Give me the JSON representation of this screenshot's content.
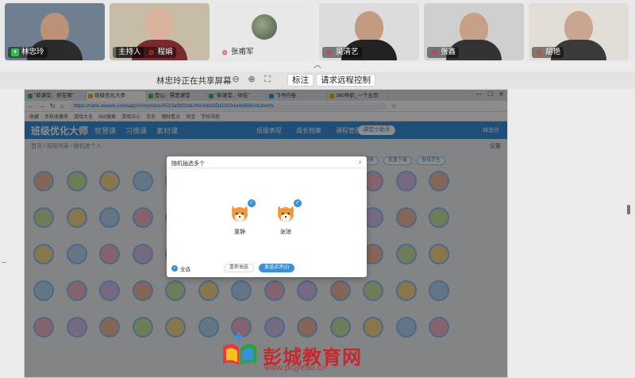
{
  "participants": [
    {
      "name": "林忠玲",
      "role": "",
      "mic": "on"
    },
    {
      "name": "程娟",
      "role": "主持人",
      "mic": "off"
    },
    {
      "name": "张甫军",
      "role": "",
      "mic": "off"
    },
    {
      "name": "吴清艺",
      "role": "",
      "mic": "off"
    },
    {
      "name": "张鑫",
      "role": "",
      "mic": "off"
    },
    {
      "name": "胡艳",
      "role": "",
      "mic": "off"
    }
  ],
  "share_bar": {
    "status_text": "林忠玲正在共享屏幕",
    "annotate_label": "标注",
    "remote_control_label": "请求远程控制"
  },
  "browser": {
    "tabs": [
      {
        "title": "\"新课堂、好在哪\"",
        "active": false
      },
      {
        "title": "班级优化大师",
        "active": true
      },
      {
        "title": "登山 · 慧思课堂",
        "active": false
      },
      {
        "title": "\"新课堂、你在\"",
        "active": false
      },
      {
        "title": "飞书问卷",
        "active": false
      },
      {
        "title": "360导航_一个主页",
        "active": false
      }
    ],
    "url": "https://care.seewo.com/app/#/myclass/4510a9bf1b624e0ebd35d10184a4d666/students",
    "bookmarks": [
      "收藏",
      "手机收藏夹",
      "游戏大全",
      "360搜索",
      "游戏中心",
      "京东",
      "理财看点",
      "淘宝",
      "学校导航"
    ]
  },
  "app": {
    "logo": "班级优化大师",
    "nav": [
      "智慧课",
      "习惯课",
      "素材课"
    ],
    "tabs": [
      "班级表现",
      "成长档案",
      "课程管理"
    ],
    "cta": "课堂小助手",
    "user": "林忠玲",
    "breadcrumb": "首页 / 班级列表 / 随机选个人",
    "settings": "设置",
    "toolbar": [
      "考勤报表",
      "批量下载",
      "查找学生"
    ]
  },
  "modal": {
    "title": "随机抽选多个",
    "close": "×",
    "picked": [
      {
        "name": "童静"
      },
      {
        "name": "张琼"
      }
    ],
    "select_all": "全选",
    "reselect": "重新抽选",
    "send": "发送点评(2)"
  },
  "watermark": {
    "title": "彭城教育网",
    "url": "www.pcjyedu.cn"
  },
  "colors": {
    "accent": "#3a8fd8",
    "mic_on": "#2fbf4a",
    "mic_off": "#e0333a",
    "watermark": "#c8282c"
  }
}
